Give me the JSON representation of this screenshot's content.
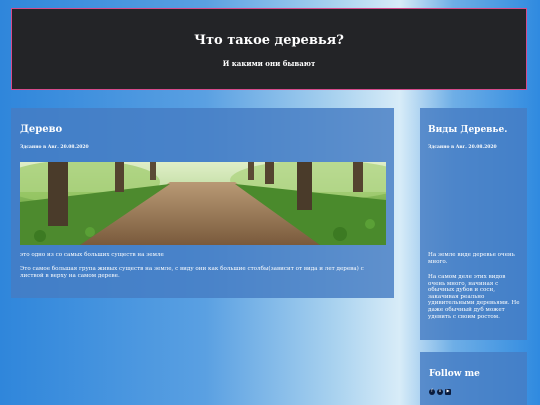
{
  "header": {
    "title": "Что такое деревья?",
    "subtitle": "И какими они бывают"
  },
  "main_post": {
    "title": "Дерево",
    "date": "Здсанно в Авг. 20.08.2020",
    "image_alt": "forest path",
    "paragraph1": "это одно из со самых больших существ на земле",
    "paragraph2": "Это самое большая група живых существ на земле, с виду они как большие столбы(зависит от вида и лет дерева) с листвой в верху на самом дереве."
  },
  "side_post": {
    "title": "Виды Деревье.",
    "date": "Здсанно в Авг. 20.08.2020",
    "paragraph1": "На земле виде деревье очень много.",
    "paragraph2": "На самом деле этих видов очень много, начиная с обычных дубов и сосн, закачивая реально удивительными деревьями. Не даже обычный дуб может удевить с своим ростом."
  },
  "follow": {
    "title": "Follow me",
    "icons": [
      "facebook-icon",
      "instagram-icon",
      "youtube-icon"
    ]
  },
  "colors": {
    "header_bg": "#232427",
    "header_border": "#d64b8b",
    "card_bg": "#467dc3"
  }
}
